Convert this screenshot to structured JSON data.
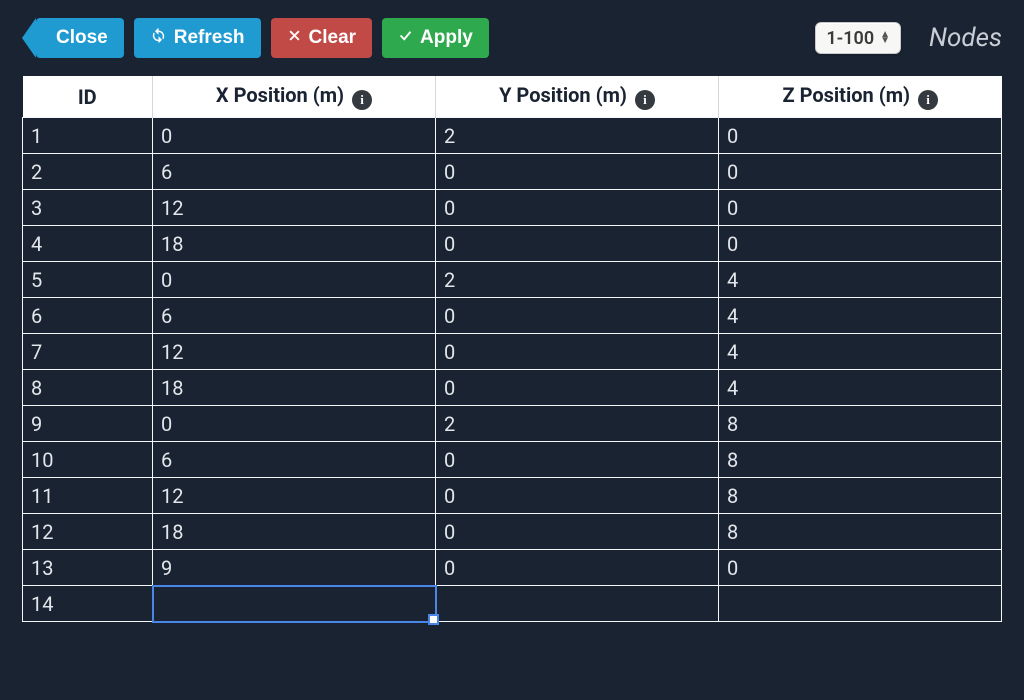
{
  "toolbar": {
    "close_label": "Close",
    "refresh_label": "Refresh",
    "clear_label": "Clear",
    "apply_label": "Apply"
  },
  "range_selector": {
    "value": "1-100"
  },
  "page_title": "Nodes",
  "table": {
    "columns": {
      "id": "ID",
      "x": "X Position (m)",
      "y": "Y Position (m)",
      "z": "Z Position (m)"
    },
    "rows": [
      {
        "id": "1",
        "x": "0",
        "y": "2",
        "z": "0"
      },
      {
        "id": "2",
        "x": "6",
        "y": "0",
        "z": "0"
      },
      {
        "id": "3",
        "x": "12",
        "y": "0",
        "z": "0"
      },
      {
        "id": "4",
        "x": "18",
        "y": "0",
        "z": "0"
      },
      {
        "id": "5",
        "x": "0",
        "y": "2",
        "z": "4"
      },
      {
        "id": "6",
        "x": "6",
        "y": "0",
        "z": "4"
      },
      {
        "id": "7",
        "x": "12",
        "y": "0",
        "z": "4"
      },
      {
        "id": "8",
        "x": "18",
        "y": "0",
        "z": "4"
      },
      {
        "id": "9",
        "x": "0",
        "y": "2",
        "z": "8"
      },
      {
        "id": "10",
        "x": "6",
        "y": "0",
        "z": "8"
      },
      {
        "id": "11",
        "x": "12",
        "y": "0",
        "z": "8"
      },
      {
        "id": "12",
        "x": "18",
        "y": "0",
        "z": "8"
      },
      {
        "id": "13",
        "x": "9",
        "y": "0",
        "z": "0"
      },
      {
        "id": "14",
        "x": "",
        "y": "",
        "z": ""
      }
    ],
    "active_cell": {
      "row_index": 13,
      "col": "x"
    }
  }
}
